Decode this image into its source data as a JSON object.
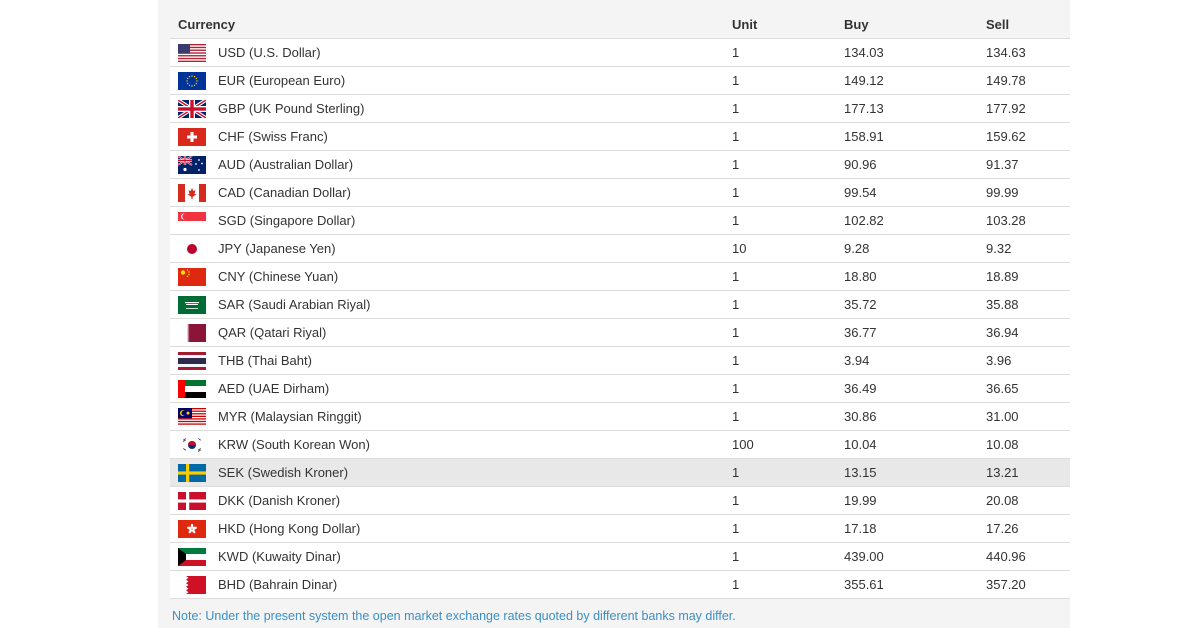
{
  "headers": {
    "currency": "Currency",
    "unit": "Unit",
    "buy": "Buy",
    "sell": "Sell"
  },
  "rows": [
    {
      "flag": "us-flag-icon",
      "name": "USD (U.S. Dollar)",
      "unit": "1",
      "buy": "134.03",
      "sell": "134.63"
    },
    {
      "flag": "eu-flag-icon",
      "name": "EUR (European Euro)",
      "unit": "1",
      "buy": "149.12",
      "sell": "149.78"
    },
    {
      "flag": "uk-flag-icon",
      "name": "GBP (UK Pound Sterling)",
      "unit": "1",
      "buy": "177.13",
      "sell": "177.92"
    },
    {
      "flag": "ch-flag-icon",
      "name": "CHF (Swiss Franc)",
      "unit": "1",
      "buy": "158.91",
      "sell": "159.62"
    },
    {
      "flag": "au-flag-icon",
      "name": "AUD (Australian Dollar)",
      "unit": "1",
      "buy": "90.96",
      "sell": "91.37"
    },
    {
      "flag": "ca-flag-icon",
      "name": "CAD (Canadian Dollar)",
      "unit": "1",
      "buy": "99.54",
      "sell": "99.99"
    },
    {
      "flag": "sg-flag-icon",
      "name": "SGD (Singapore Dollar)",
      "unit": "1",
      "buy": "102.82",
      "sell": "103.28"
    },
    {
      "flag": "jp-flag-icon",
      "name": "JPY (Japanese Yen)",
      "unit": "10",
      "buy": "9.28",
      "sell": "9.32"
    },
    {
      "flag": "cn-flag-icon",
      "name": "CNY (Chinese Yuan)",
      "unit": "1",
      "buy": "18.80",
      "sell": "18.89"
    },
    {
      "flag": "sa-flag-icon",
      "name": "SAR (Saudi Arabian Riyal)",
      "unit": "1",
      "buy": "35.72",
      "sell": "35.88"
    },
    {
      "flag": "qa-flag-icon",
      "name": "QAR (Qatari Riyal)",
      "unit": "1",
      "buy": "36.77",
      "sell": "36.94"
    },
    {
      "flag": "th-flag-icon",
      "name": "THB (Thai Baht)",
      "unit": "1",
      "buy": "3.94",
      "sell": "3.96"
    },
    {
      "flag": "ae-flag-icon",
      "name": "AED (UAE Dirham)",
      "unit": "1",
      "buy": "36.49",
      "sell": "36.65"
    },
    {
      "flag": "my-flag-icon",
      "name": "MYR (Malaysian Ringgit)",
      "unit": "1",
      "buy": "30.86",
      "sell": "31.00"
    },
    {
      "flag": "kr-flag-icon",
      "name": "KRW (South Korean Won)",
      "unit": "100",
      "buy": "10.04",
      "sell": "10.08"
    },
    {
      "flag": "se-flag-icon",
      "name": "SEK (Swedish Kroner)",
      "unit": "1",
      "buy": "13.15",
      "sell": "13.21"
    },
    {
      "flag": "dk-flag-icon",
      "name": "DKK (Danish Kroner)",
      "unit": "1",
      "buy": "19.99",
      "sell": "20.08"
    },
    {
      "flag": "hk-flag-icon",
      "name": "HKD (Hong Kong Dollar)",
      "unit": "1",
      "buy": "17.18",
      "sell": "17.26"
    },
    {
      "flag": "kw-flag-icon",
      "name": "KWD (Kuwaity Dinar)",
      "unit": "1",
      "buy": "439.00",
      "sell": "440.96"
    },
    {
      "flag": "bh-flag-icon",
      "name": "BHD (Bahrain Dinar)",
      "unit": "1",
      "buy": "355.61",
      "sell": "357.20"
    }
  ],
  "highlighted_row": "SEK (Swedish Kroner)",
  "note": "Note: Under the present system the open market exchange rates quoted by different banks may differ.",
  "colors": {
    "note_text": "#3a8fc4",
    "row_highlight": "#e8e8e8",
    "panel_bg": "#f4f4f4"
  }
}
